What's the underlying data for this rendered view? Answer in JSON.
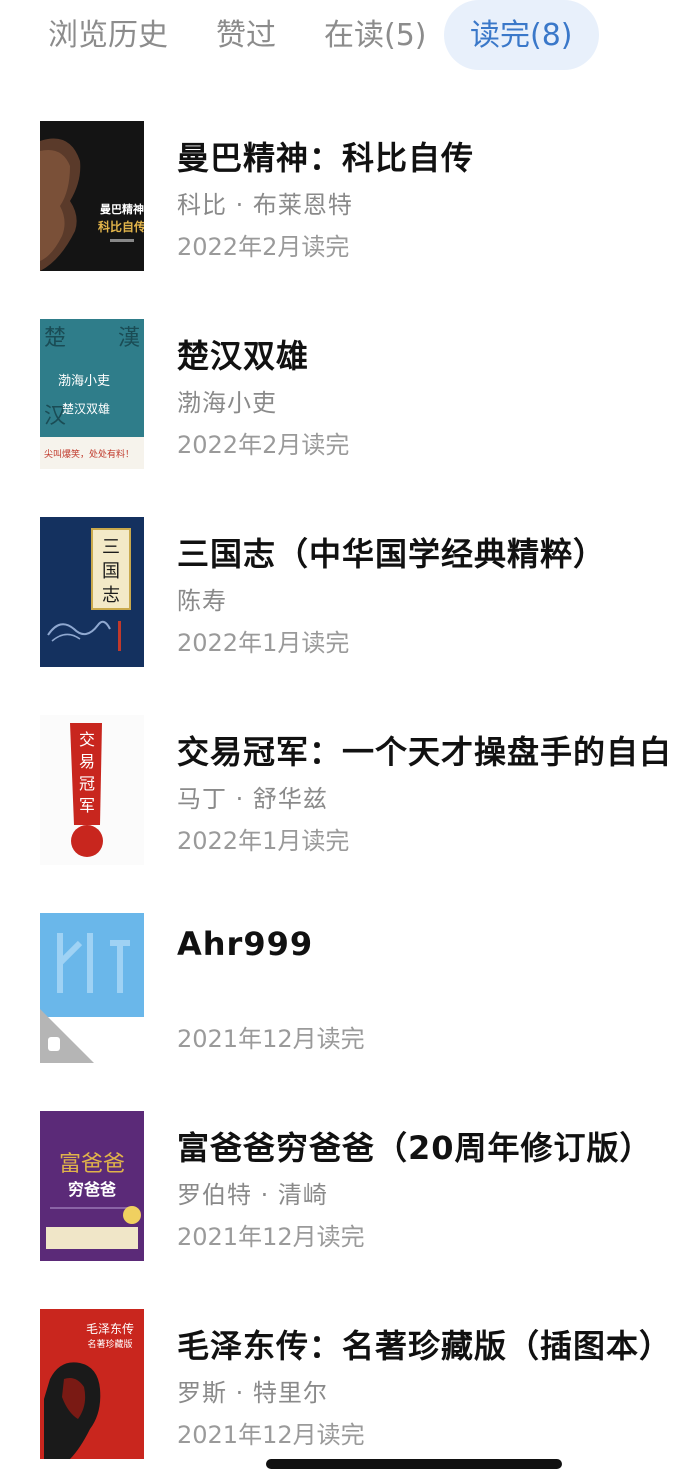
{
  "tabs": [
    {
      "label": "浏览历史",
      "active": false
    },
    {
      "label": "赞过",
      "active": false
    },
    {
      "label": "在读(5)",
      "active": false
    },
    {
      "label": "读完(8)",
      "active": true
    }
  ],
  "books": [
    {
      "title": "曼巴精神：科比自传",
      "author": "科比 · 布莱恩特",
      "date": "2022年2月读完",
      "cover": {
        "text": [
          "曼巴精神",
          "科比自传"
        ]
      }
    },
    {
      "title": "楚汉双雄",
      "author": "渤海小吏",
      "date": "2022年2月读完",
      "cover": {
        "text": [
          "楚",
          "漢",
          "汉",
          "渤海小吏",
          "楚汉双雄",
          "尖叫爆笑，处处有料！"
        ]
      }
    },
    {
      "title": "三国志（中华国学经典精粹）",
      "author": "陈寿",
      "date": "2022年1月读完",
      "cover": {
        "text": [
          "三",
          "国",
          "志"
        ]
      }
    },
    {
      "title": "交易冠军：一个天才操盘手的自白",
      "author": "马丁 · 舒华兹",
      "date": "2022年1月读完",
      "cover": {
        "text": [
          "交",
          "易",
          "冠",
          "军"
        ]
      }
    },
    {
      "title": "Ahr999",
      "author": "",
      "date": "2021年12月读完",
      "cover": {
        "text": []
      }
    },
    {
      "title": "富爸爸穷爸爸（20周年修订版）",
      "author": "罗伯特 · 清崎",
      "date": "2021年12月读完",
      "cover": {
        "text": [
          "富爸爸",
          "穷爸爸"
        ]
      }
    },
    {
      "title": "毛泽东传：名著珍藏版（插图本）",
      "author": "罗斯 · 特里尔",
      "date": "2021年12月读完",
      "cover": {
        "text": [
          "毛泽东传",
          "名著珍藏版"
        ]
      }
    }
  ],
  "colors": {
    "accent": "#3a78c9",
    "accent_bg": "#e8f0fb",
    "muted": "#8a8a8a"
  }
}
